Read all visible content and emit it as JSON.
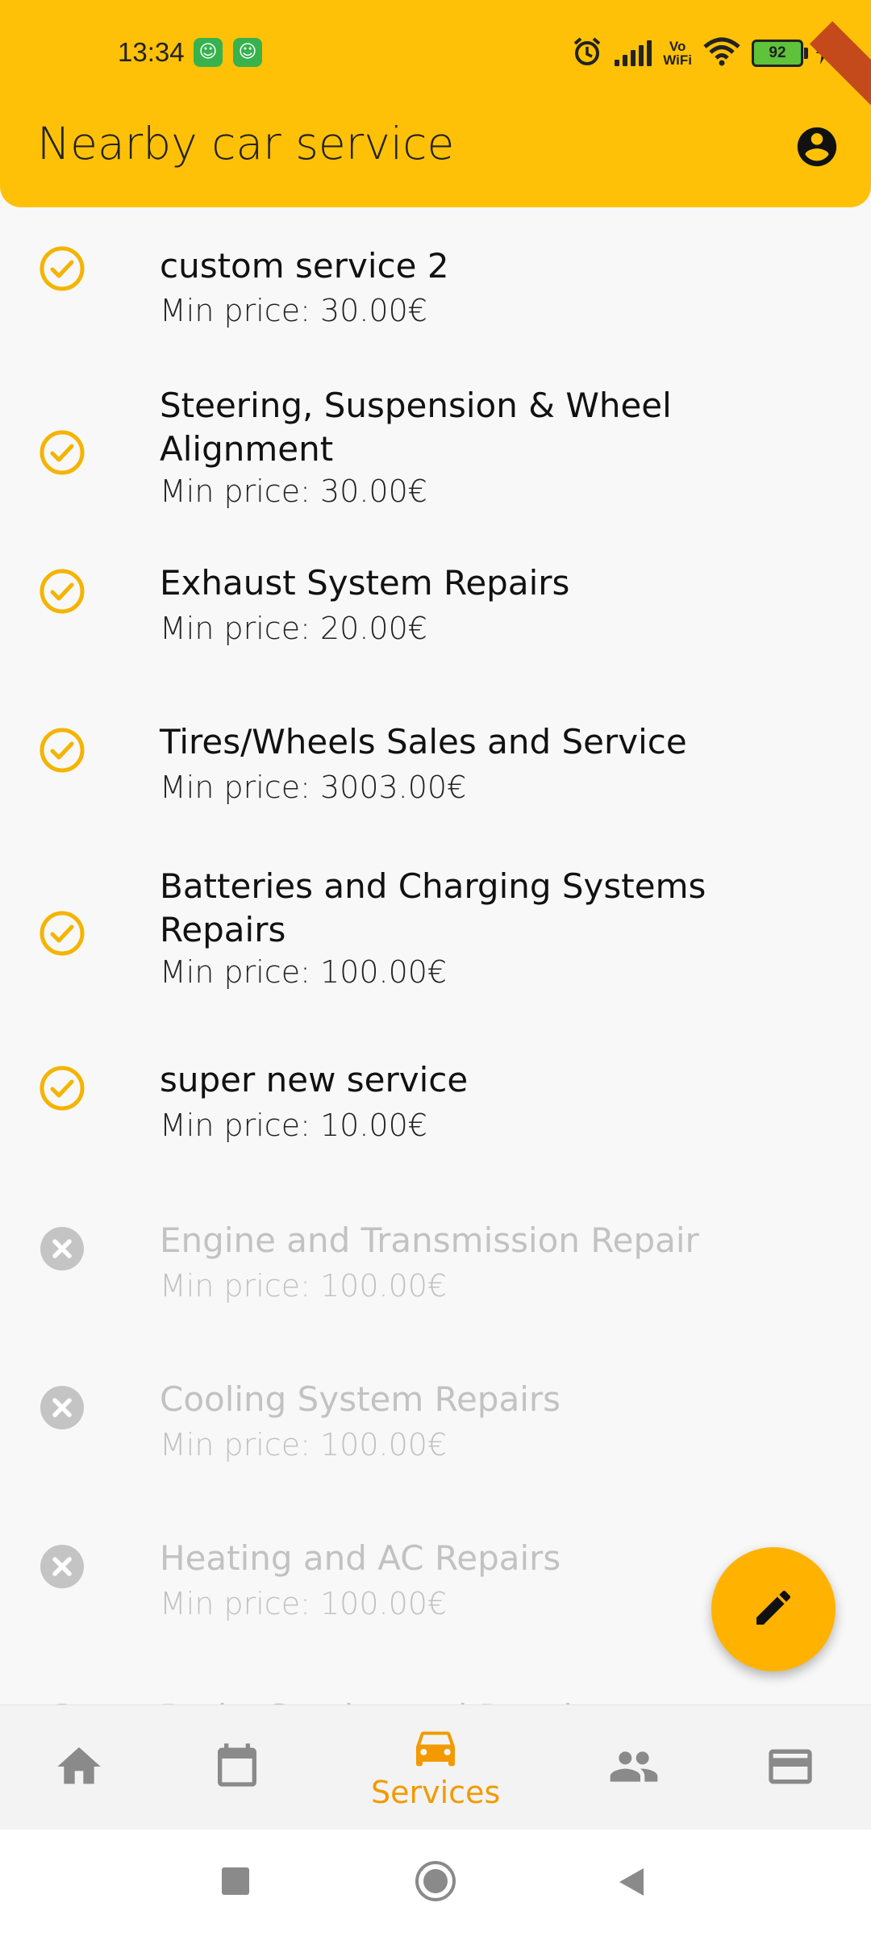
{
  "status_bar": {
    "time": "13:34",
    "notification_icons": [
      "app-notification-icon",
      "app-notification-icon"
    ],
    "vowifi_top": "Vo",
    "vowifi_bottom": "WiFi",
    "battery_level": "92"
  },
  "appbar": {
    "title": "Nearby car service",
    "account_icon": "account-circle-icon"
  },
  "services": [
    {
      "name": "custom service 2",
      "price": "Min price: 30.00€",
      "enabled": true
    },
    {
      "name": "Steering, Suspension & Wheel Alignment",
      "price": "Min price: 30.00€",
      "enabled": true
    },
    {
      "name": "Exhaust System Repairs",
      "price": "Min price: 20.00€",
      "enabled": true
    },
    {
      "name": "Tires/Wheels Sales and Service",
      "price": "Min price: 3003.00€",
      "enabled": true
    },
    {
      "name": "Batteries and Charging Systems Repairs",
      "price": "Min price: 100.00€",
      "enabled": true
    },
    {
      "name": "super new service",
      "price": "Min price: 10.00€",
      "enabled": true
    },
    {
      "name": "Engine and Transmission Repair",
      "price": "Min price: 100.00€",
      "enabled": false
    },
    {
      "name": "Cooling System Repairs",
      "price": "Min price: 100.00€",
      "enabled": false
    },
    {
      "name": "Heating and AC Repairs",
      "price": "Min price: 100.00€",
      "enabled": false
    },
    {
      "name": "Brake Service and Repair",
      "price": "",
      "enabled": false
    }
  ],
  "fab": {
    "icon": "edit-pencil-icon"
  },
  "bottom_nav": {
    "items": [
      {
        "icon": "home-icon",
        "label": "",
        "active": false
      },
      {
        "icon": "calendar-icon",
        "label": "",
        "active": false
      },
      {
        "icon": "car-icon",
        "label": "Services",
        "active": true
      },
      {
        "icon": "people-icon",
        "label": "",
        "active": false
      },
      {
        "icon": "credit-card-icon",
        "label": "",
        "active": false
      }
    ]
  },
  "system_nav": {
    "icons": [
      "recent-apps-icon",
      "home-circle-icon",
      "back-icon"
    ]
  },
  "colors": {
    "primary": "#ffc107",
    "fab": "#ffb300",
    "accent": "#f29a00",
    "enabled_icon": "#f4b400",
    "disabled_icon": "#c4c4c4",
    "disabled_text": "#c2c2c2"
  }
}
